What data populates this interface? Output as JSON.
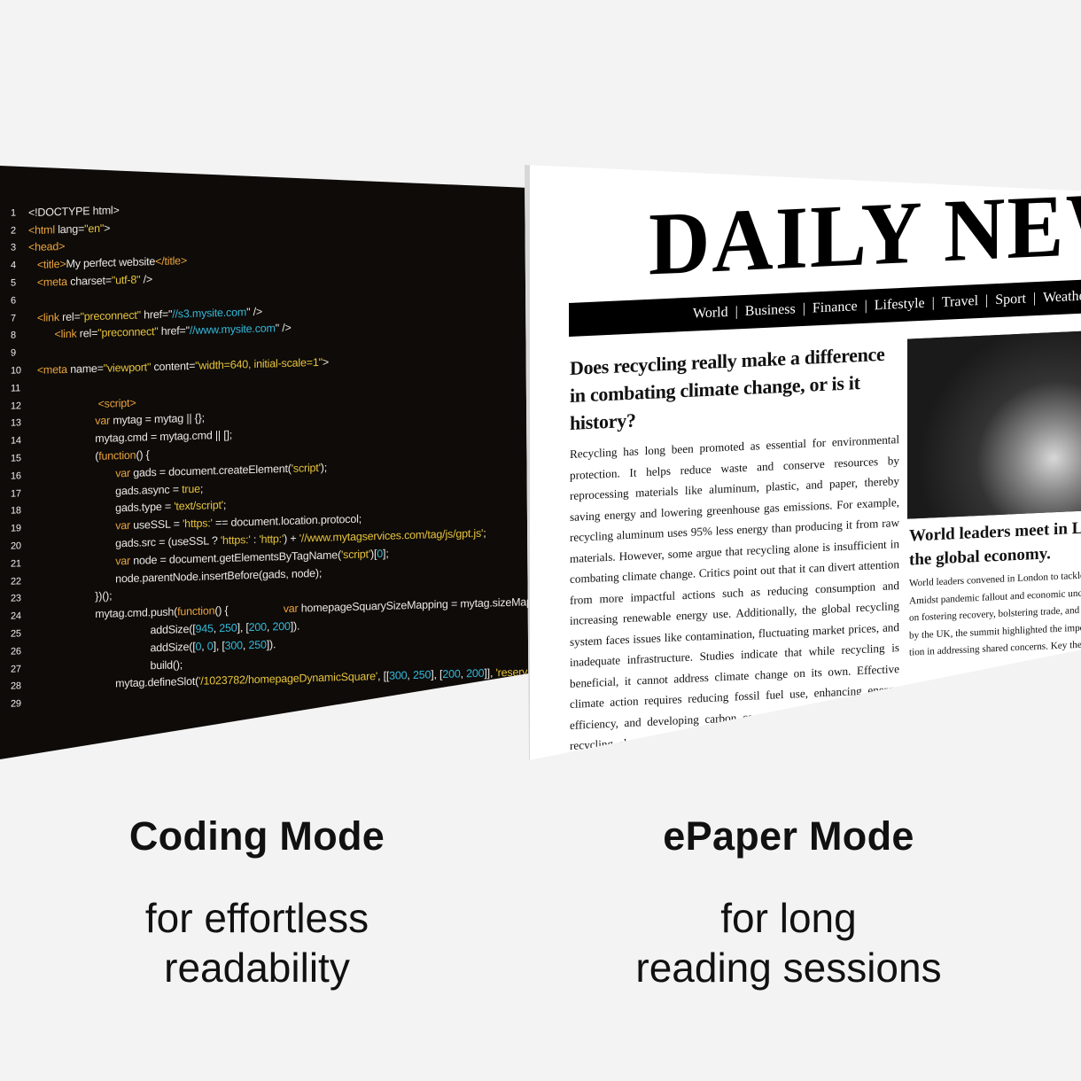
{
  "code_panel": {
    "lines": [
      [
        [
          "t-txt",
          "<!DOCTYPE html>"
        ]
      ],
      [
        [
          "t-tag",
          "<html"
        ],
        [
          "t-txt",
          " lang="
        ],
        [
          "t-str",
          "\"en\""
        ],
        [
          "t-txt",
          ">"
        ]
      ],
      [
        [
          "t-tag",
          "<head>"
        ]
      ],
      [
        [
          "t-txt",
          "   "
        ],
        [
          "t-tag",
          "<title>"
        ],
        [
          "t-txt",
          "My perfect website"
        ],
        [
          "t-tag",
          "</title>"
        ]
      ],
      [
        [
          "t-txt",
          "   "
        ],
        [
          "t-tag",
          "<meta"
        ],
        [
          "t-txt",
          " charset="
        ],
        [
          "t-str",
          "\"utf-8\""
        ],
        [
          "t-txt",
          " />"
        ]
      ],
      [],
      [
        [
          "t-txt",
          "   "
        ],
        [
          "t-tag",
          "<link"
        ],
        [
          "t-txt",
          " rel="
        ],
        [
          "t-str",
          "\"preconnect\""
        ],
        [
          "t-txt",
          " href=\""
        ],
        [
          "t-url",
          "//s3.mysite.com"
        ],
        [
          "t-txt",
          "\" />"
        ]
      ],
      [
        [
          "t-txt",
          "         "
        ],
        [
          "t-tag",
          "<link"
        ],
        [
          "t-txt",
          " rel="
        ],
        [
          "t-str",
          "\"preconnect\""
        ],
        [
          "t-txt",
          " href=\""
        ],
        [
          "t-url",
          "//www.mysite.com"
        ],
        [
          "t-txt",
          "\" />"
        ]
      ],
      [],
      [
        [
          "t-txt",
          "   "
        ],
        [
          "t-tag",
          "<meta"
        ],
        [
          "t-txt",
          " name="
        ],
        [
          "t-str",
          "\"viewport\""
        ],
        [
          "t-txt",
          " content="
        ],
        [
          "t-str",
          "\"width=640, initial-scale=1\""
        ],
        [
          "t-txt",
          ">"
        ]
      ],
      [],
      [
        [
          "t-txt",
          "                        "
        ],
        [
          "t-tag",
          "<script>"
        ]
      ],
      [
        [
          "t-txt",
          "                       "
        ],
        [
          "t-kw",
          "var"
        ],
        [
          "t-txt",
          " mytag = mytag || {};"
        ]
      ],
      [
        [
          "t-txt",
          "                       mytag.cmd = mytag.cmd || [];"
        ]
      ],
      [
        [
          "t-txt",
          "                       ("
        ],
        [
          "t-kw",
          "function"
        ],
        [
          "t-txt",
          "() {"
        ]
      ],
      [
        [
          "t-txt",
          "                              "
        ],
        [
          "t-kw",
          "var"
        ],
        [
          "t-txt",
          " gads = document.createElement("
        ],
        [
          "t-str",
          "'script'"
        ],
        [
          "t-txt",
          ");"
        ]
      ],
      [
        [
          "t-txt",
          "                              gads.async = "
        ],
        [
          "t-str",
          "true"
        ],
        [
          "t-txt",
          ";"
        ]
      ],
      [
        [
          "t-txt",
          "                              gads.type = "
        ],
        [
          "t-str",
          "'text/script'"
        ],
        [
          "t-txt",
          ";"
        ]
      ],
      [
        [
          "t-txt",
          "                              "
        ],
        [
          "t-kw",
          "var"
        ],
        [
          "t-txt",
          " useSSL = "
        ],
        [
          "t-str",
          "'https:'"
        ],
        [
          "t-txt",
          " == document.location.protocol;"
        ]
      ],
      [
        [
          "t-txt",
          "                              gads.src = (useSSL ? "
        ],
        [
          "t-str",
          "'https:'"
        ],
        [
          "t-txt",
          " : "
        ],
        [
          "t-str",
          "'http:'"
        ],
        [
          "t-txt",
          ") + "
        ],
        [
          "t-str",
          "'//www.mytagservices.com/tag/js/gpt.js'"
        ],
        [
          "t-txt",
          ";"
        ]
      ],
      [
        [
          "t-txt",
          "                              "
        ],
        [
          "t-kw",
          "var"
        ],
        [
          "t-txt",
          " node = document.getElementsByTagName("
        ],
        [
          "t-str",
          "'script'"
        ],
        [
          "t-txt",
          ")["
        ],
        [
          "t-num",
          "0"
        ],
        [
          "t-txt",
          "];"
        ]
      ],
      [
        [
          "t-txt",
          "                              node.parentNode.insertBefore(gads, node);"
        ]
      ],
      [
        [
          "t-txt",
          "                       })();"
        ]
      ],
      [
        [
          "t-txt",
          "                       mytag.cmd.push("
        ],
        [
          "t-kw",
          "function"
        ],
        [
          "t-txt",
          "() {                   "
        ],
        [
          "t-kw",
          "var"
        ],
        [
          "t-txt",
          " homepageSquarySizeMapping = mytag.sizeMapping()."
        ]
      ],
      [
        [
          "t-txt",
          "                                          addSize(["
        ],
        [
          "t-num",
          "945"
        ],
        [
          "t-txt",
          ", "
        ],
        [
          "t-num",
          "250"
        ],
        [
          "t-txt",
          "], ["
        ],
        [
          "t-num",
          "200"
        ],
        [
          "t-txt",
          ", "
        ],
        [
          "t-num",
          "200"
        ],
        [
          "t-txt",
          "])."
        ]
      ],
      [
        [
          "t-txt",
          "                                          addSize(["
        ],
        [
          "t-num",
          "0"
        ],
        [
          "t-txt",
          ", "
        ],
        [
          "t-num",
          "0"
        ],
        [
          "t-txt",
          "], ["
        ],
        [
          "t-num",
          "300"
        ],
        [
          "t-txt",
          ", "
        ],
        [
          "t-num",
          "250"
        ],
        [
          "t-txt",
          "])."
        ]
      ],
      [
        [
          "t-txt",
          "                                          build();"
        ]
      ],
      [
        [
          "t-txt",
          "                              mytag.defineSlot("
        ],
        [
          "t-str",
          "'/1023782/homepageDynamicSquare'"
        ],
        [
          "t-txt",
          ", [["
        ],
        [
          "t-num",
          "300"
        ],
        [
          "t-txt",
          ", "
        ],
        [
          "t-num",
          "250"
        ],
        [
          "t-txt",
          "], ["
        ],
        [
          "t-num",
          "200"
        ],
        [
          "t-txt",
          ", "
        ],
        [
          "t-num",
          "200"
        ],
        [
          "t-txt",
          "]], "
        ],
        [
          "t-str",
          "'reserv"
        ]
      ],
      []
    ]
  },
  "epaper": {
    "masthead": "DAILY NEWS",
    "nav": [
      "World",
      "Business",
      "Finance",
      "Lifestyle",
      "Travel",
      "Sport",
      "Weather"
    ],
    "article": {
      "headline": "Does recycling really make a difference in combating climate change, or is it history?",
      "body": "Recycling has long been promoted as essential for environmental protection. It helps reduce waste and conserve resources by reprocessing materials like aluminum, plastic, and paper, thereby saving energy and lowering greenhouse gas emissions. For example, recycling aluminum uses 95% less energy than producing it from raw materials. However, some argue that recycling alone is insufficient in combating climate change. Critics point out that it can divert attention from more impactful actions such as reducing consumption and increasing renewable energy use. Additionally, the global recycling system faces issues like contamination, fluctuating market prices, and inadequate infrastructure. Studies indicate that while recycling is beneficial, it cannot address climate change on its own. Effective climate action requires reducing fossil fuel use, enhancing energy efficiency, and developing carbon capture technologies. Therefore, recycling should be part of a broader strategy to combat climate change effectively."
    },
    "side_story": {
      "headline_1": "World leaders meet in London",
      "headline_2": "the global economy.",
      "lines": [
        "World leaders convened in London to tackle glob",
        "Amidst pandemic fallout and economic uncertaint",
        "on fostering recovery, bolstering trade, and promo",
        "by the UK, the summit highlighted the importance",
        "tion in addressing shared concerns. Key themes"
      ]
    }
  },
  "captions": {
    "coding": {
      "title": "Coding Mode",
      "line1": "for effortless",
      "line2": "readability"
    },
    "epaper": {
      "title": "ePaper Mode",
      "line1": "for long",
      "line2": "reading sessions"
    }
  }
}
